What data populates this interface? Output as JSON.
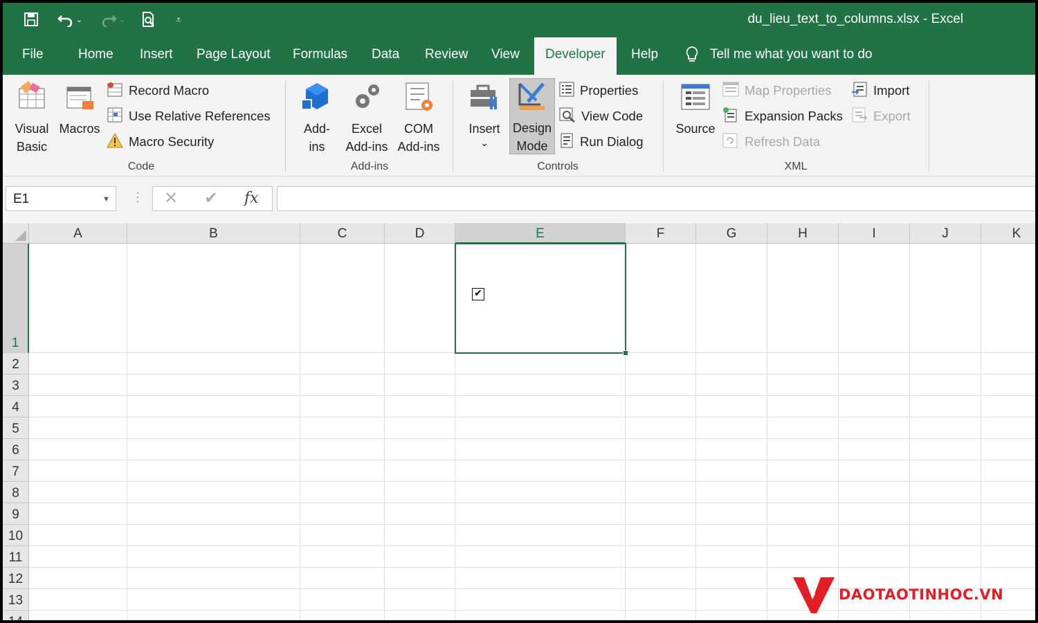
{
  "window": {
    "title": "du_lieu_text_to_columns.xlsx  -  Excel",
    "accent_color": "#217346"
  },
  "quick_access": {
    "items": [
      "save-icon",
      "undo-icon",
      "redo-icon",
      "print-preview-icon",
      "customize-icon"
    ]
  },
  "tabs": [
    {
      "label": "File"
    },
    {
      "label": "Home"
    },
    {
      "label": "Insert"
    },
    {
      "label": "Page Layout"
    },
    {
      "label": "Formulas"
    },
    {
      "label": "Data"
    },
    {
      "label": "Review"
    },
    {
      "label": "View"
    },
    {
      "label": "Developer",
      "active": true
    },
    {
      "label": "Help"
    }
  ],
  "tell_me": "Tell me what you want to do",
  "ribbon": {
    "code": {
      "label": "Code",
      "visual_basic_1": "Visual",
      "visual_basic_2": "Basic",
      "macros": "Macros",
      "record_macro": "Record Macro",
      "use_relative": "Use Relative References",
      "macro_security": "Macro Security"
    },
    "addins": {
      "label": "Add-ins",
      "addins_1": "Add-",
      "addins_2": "ins",
      "excel_addins_1": "Excel",
      "excel_addins_2": "Add-ins",
      "com_addins_1": "COM",
      "com_addins_2": "Add-ins"
    },
    "controls": {
      "label": "Controls",
      "insert": "Insert",
      "design_mode_1": "Design",
      "design_mode_2": "Mode",
      "design_mode_pressed": true,
      "properties": "Properties",
      "view_code": "View Code",
      "run_dialog": "Run Dialog"
    },
    "xml": {
      "label": "XML",
      "source": "Source",
      "map_properties": "Map Properties",
      "expansion_packs": "Expansion Packs",
      "refresh_data": "Refresh Data",
      "import": "Import",
      "export": "Export"
    }
  },
  "formula_bar": {
    "name_box": "E1",
    "fx": "fx",
    "cancel": "✕",
    "enter": "✔",
    "value": ""
  },
  "sheet": {
    "columns": [
      "A",
      "B",
      "C",
      "D",
      "E",
      "F",
      "G",
      "H",
      "I",
      "J",
      "K"
    ],
    "rows": [
      "1",
      "2",
      "3",
      "4",
      "5",
      "6",
      "7",
      "8",
      "9",
      "10",
      "11",
      "12",
      "13",
      "14"
    ],
    "selected_cell": "E1",
    "checkbox_checked": true,
    "checkbox_mark": "✔"
  },
  "watermark": {
    "text": "DAOTAOTINHOC.VN",
    "color": "#e31e24"
  }
}
